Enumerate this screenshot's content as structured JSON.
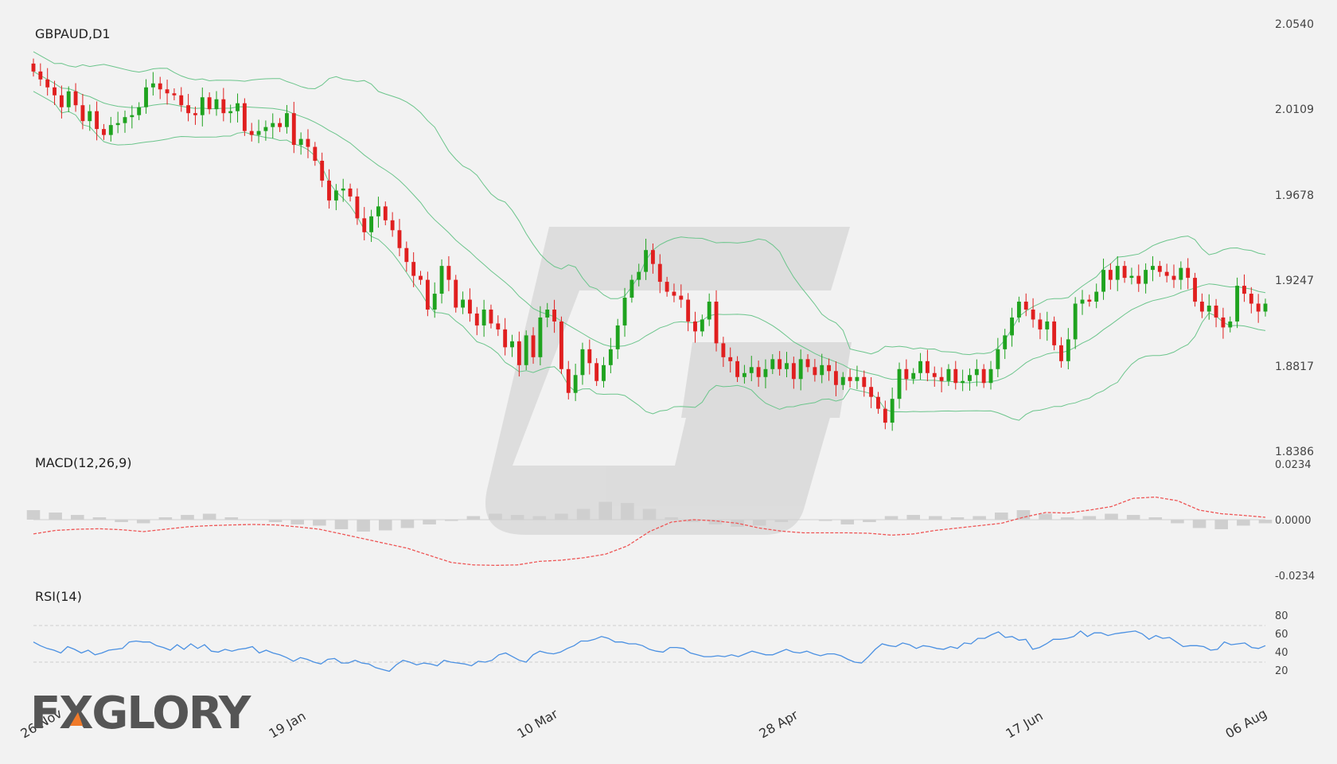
{
  "chart_data": [
    {
      "type": "candlestick",
      "title": "GBPAUD,D1",
      "ylim": [
        1.8386,
        2.054
      ],
      "yticks": [
        "2.0540",
        "2.0109",
        "1.9678",
        "1.9247",
        "1.8817",
        "1.8386"
      ],
      "xticks": [
        "26 Nov",
        "19 Jan",
        "10 Mar",
        "28 Apr",
        "17 Jun",
        "06 Aug"
      ],
      "overlay": "bollinger-bands",
      "close": [
        2.03,
        2.026,
        2.022,
        2.018,
        2.012,
        2.02,
        2.013,
        2.005,
        2.01,
        2.001,
        1.998,
        2.003,
        2.004,
        2.007,
        2.008,
        2.012,
        2.022,
        2.024,
        2.021,
        2.019,
        2.018,
        2.013,
        2.009,
        2.008,
        2.017,
        2.011,
        2.016,
        2.009,
        2.01,
        2.014,
        2.0,
        1.998,
        2.0,
        2.002,
        2.004,
        2.002,
        2.009,
        1.993,
        1.996,
        1.992,
        1.985,
        1.975,
        1.965,
        1.97,
        1.971,
        1.967,
        1.956,
        1.949,
        1.957,
        1.962,
        1.955,
        1.95,
        1.941,
        1.934,
        1.927,
        1.925,
        1.91,
        1.918,
        1.932,
        1.925,
        1.911,
        1.915,
        1.908,
        1.902,
        1.91,
        1.903,
        1.9,
        1.891,
        1.894,
        1.882,
        1.897,
        1.886,
        1.906,
        1.91,
        1.904,
        1.88,
        1.868,
        1.877,
        1.89,
        1.883,
        1.874,
        1.882,
        1.89,
        1.902,
        1.916,
        1.925,
        1.929,
        1.94,
        1.933,
        1.924,
        1.919,
        1.917,
        1.915,
        1.904,
        1.899,
        1.905,
        1.914,
        1.893,
        1.886,
        1.884,
        1.876,
        1.878,
        1.881,
        1.876,
        1.88,
        1.885,
        1.88,
        1.883,
        1.875,
        1.885,
        1.881,
        1.877,
        1.882,
        1.879,
        1.872,
        1.876,
        1.874,
        1.876,
        1.871,
        1.866,
        1.86,
        1.853,
        1.865,
        1.88,
        1.875,
        1.878,
        1.884,
        1.878,
        1.876,
        1.874,
        1.88,
        1.873,
        1.874,
        1.877,
        1.88,
        1.873,
        1.88,
        1.89,
        1.897,
        1.906,
        1.914,
        1.91,
        1.905,
        1.9,
        1.904,
        1.892,
        1.884,
        1.895,
        1.913,
        1.915,
        1.914,
        1.919,
        1.93,
        1.925,
        1.932,
        1.926,
        1.927,
        1.923,
        1.93,
        1.932,
        1.929,
        1.927,
        1.925,
        1.931,
        1.926,
        1.914,
        1.909,
        1.912,
        1.906,
        1.901,
        1.904,
        1.922,
        1.918,
        1.913,
        1.909,
        1.913
      ]
    },
    {
      "type": "line",
      "title": "MACD(12,26,9)",
      "ylim": [
        -0.0234,
        0.0234
      ],
      "yticks": [
        "0.0234",
        "0.0000",
        "-0.0234"
      ],
      "series": [
        {
          "values": [
            -0.006,
            -0.0045,
            -0.004,
            -0.0038,
            -0.0042,
            -0.005,
            -0.004,
            -0.003,
            -0.0025,
            -0.0022,
            -0.002,
            -0.0022,
            -0.003,
            -0.004,
            -0.006,
            -0.008,
            -0.01,
            -0.012,
            -0.015,
            -0.018,
            -0.019,
            -0.0192,
            -0.019,
            -0.0175,
            -0.017,
            -0.016,
            -0.0145,
            -0.011,
            -0.005,
            -0.001,
            0.0,
            -0.0005,
            -0.0015,
            -0.0035,
            -0.0048,
            -0.0055,
            -0.0055,
            -0.0055,
            -0.0057,
            -0.0065,
            -0.006,
            -0.0045,
            -0.0035,
            -0.0025,
            -0.0015,
            0.001,
            0.003,
            0.0028,
            0.004,
            0.0055,
            0.009,
            0.0095,
            0.008,
            0.004,
            0.0025,
            0.0018,
            0.001
          ]
        }
      ],
      "histogram": [
        0.004,
        0.003,
        0.002,
        0.001,
        -0.001,
        -0.0015,
        0.001,
        0.002,
        0.0025,
        0.001,
        0.0,
        -0.001,
        -0.002,
        -0.0025,
        -0.004,
        -0.005,
        -0.0045,
        -0.0035,
        -0.002,
        -0.0005,
        0.0015,
        0.0025,
        0.002,
        0.0015,
        0.0025,
        0.0045,
        0.0075,
        0.007,
        0.0045,
        0.001,
        -0.001,
        -0.002,
        -0.003,
        -0.0025,
        -0.001,
        0.0,
        -0.0005,
        -0.002,
        -0.001,
        0.0015,
        0.002,
        0.0015,
        0.001,
        0.0015,
        0.003,
        0.004,
        0.0025,
        0.001,
        0.0015,
        0.0025,
        0.002,
        0.001,
        -0.0015,
        -0.0035,
        -0.004,
        -0.0025,
        -0.0015
      ]
    },
    {
      "type": "line",
      "title": "RSI(14)",
      "ylim": [
        10,
        90
      ],
      "yticks": [
        "80",
        "60",
        "40",
        "20"
      ],
      "levels": [
        70,
        30
      ],
      "series": [
        {
          "values": [
            52,
            48,
            45,
            43,
            40,
            47,
            44,
            40,
            43,
            38,
            40,
            43,
            44,
            45,
            52,
            53,
            52,
            52,
            48,
            46,
            43,
            49,
            44,
            50,
            45,
            49,
            42,
            41,
            44,
            42,
            44,
            45,
            47,
            40,
            43,
            40,
            38,
            35,
            31,
            35,
            33,
            30,
            28,
            33,
            34,
            29,
            29,
            32,
            29,
            28,
            24,
            22,
            20,
            27,
            32,
            30,
            27,
            29,
            28,
            26,
            32,
            30,
            29,
            28,
            26,
            31,
            30,
            32,
            38,
            40,
            36,
            32,
            30,
            38,
            42,
            40,
            39,
            41,
            45,
            48,
            53,
            53,
            55,
            58,
            56,
            52,
            52,
            50,
            50,
            48,
            44,
            42,
            41,
            46,
            46,
            45,
            40,
            38,
            36,
            36,
            37,
            36,
            38,
            36,
            39,
            42,
            40,
            38,
            38,
            41,
            44,
            41,
            40,
            42,
            39,
            37,
            39,
            39,
            37,
            33,
            30,
            29,
            36,
            44,
            50,
            48,
            47,
            51,
            49,
            45,
            48,
            47,
            45,
            44,
            47,
            45,
            51,
            50,
            56,
            56,
            60,
            63,
            57,
            58,
            54,
            55,
            44,
            46,
            50,
            55,
            55,
            56,
            58,
            64,
            58,
            62,
            62,
            59,
            61,
            62,
            63,
            64,
            61,
            55,
            59,
            56,
            57,
            52,
            47,
            48,
            48,
            47,
            43,
            44,
            52,
            49,
            50,
            51,
            46,
            45,
            48
          ]
        }
      ]
    }
  ],
  "watermark": {
    "icon": "logo-g-shape-icon",
    "color": "#d9d9d9"
  },
  "logo": {
    "text": "FXGLORY"
  },
  "colors": {
    "bull": "#1fa31f",
    "bear": "#e01f1f",
    "band": "#6cc58c",
    "macd_signal": "#ee5555",
    "hist": "#cfcfcf",
    "rsi": "#4a90e2"
  }
}
